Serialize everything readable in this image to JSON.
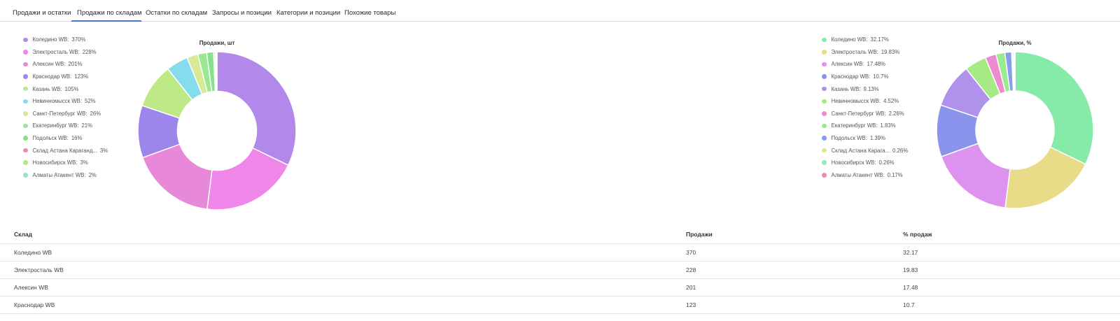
{
  "tabs": [
    {
      "label": "Продажи и остатки",
      "active": false
    },
    {
      "label": "Продажи по складам",
      "active": true
    },
    {
      "label": "Остатки по складам",
      "active": false
    },
    {
      "label": "Запросы и позиции",
      "active": false
    },
    {
      "label": "Категории и позиции",
      "active": false
    },
    {
      "label": "Похожие товары",
      "active": false
    }
  ],
  "chart_data": [
    {
      "type": "pie",
      "title": "Продажи, шт",
      "legend_position": "left",
      "categories": [
        "Коледино WB",
        "Электросталь WB",
        "Алексин WB",
        "Краснодар WB",
        "Казань WB",
        "Невинномысск WB",
        "Санкт-Петербург WB",
        "Екатеринбург WB",
        "Подольск WB",
        "Склад Астана Караганд...",
        "Новосибирск WB",
        "Алматы Атакент WB"
      ],
      "values": [
        370,
        228,
        201,
        123,
        105,
        52,
        26,
        21,
        16,
        3,
        3,
        2
      ],
      "labels": [
        "370%",
        "228%",
        "201%",
        "123%",
        "105%",
        "52%",
        "26%",
        "21%",
        "16%",
        "3%",
        "3%",
        "2%"
      ],
      "colors": [
        "#b388eb",
        "#ef87e8",
        "#e888d8",
        "#9d86eb",
        "#bdea86",
        "#86dcec",
        "#d8ea96",
        "#9ae894",
        "#86e08c",
        "#ef8aa8",
        "#b4ea86",
        "#92e8bc"
      ]
    },
    {
      "type": "pie",
      "title": "Продажи, %",
      "legend_position": "left",
      "categories": [
        "Коледино WB",
        "Электросталь WB",
        "Алексин WB",
        "Краснодар WB",
        "Казань WB",
        "Невинномысск WB",
        "Санкт-Петербург WB",
        "Екатеринбург WB",
        "Подольск WB",
        "Склад Астана Карага...",
        "Новосибирск WB",
        "Алматы Атакент WB"
      ],
      "values": [
        32.17,
        19.83,
        17.48,
        10.7,
        9.13,
        4.52,
        2.26,
        1.83,
        1.39,
        0.26,
        0.26,
        0.17
      ],
      "labels": [
        "32.17%",
        "19.83%",
        "17.48%",
        "10.7%",
        "9.13%",
        "4.52%",
        "2.26%",
        "1.83%",
        "1.39%",
        "0.26%",
        "0.26%",
        "0.17%"
      ],
      "colors": [
        "#86eaa8",
        "#e8dc88",
        "#dc92ee",
        "#8a94ec",
        "#b092ec",
        "#a6ea86",
        "#ee8ad0",
        "#9aea90",
        "#8a9cec",
        "#d8ea8e",
        "#90eaba",
        "#ee8aa4"
      ]
    }
  ],
  "table": {
    "headers": [
      "Склад",
      "Продажи",
      "% продаж"
    ],
    "rows": [
      [
        "Коледино WB",
        "370",
        "32.17"
      ],
      [
        "Электросталь WB",
        "228",
        "19.83"
      ],
      [
        "Алексин WB",
        "201",
        "17.48"
      ],
      [
        "Краснодар WB",
        "123",
        "10.7"
      ]
    ]
  }
}
